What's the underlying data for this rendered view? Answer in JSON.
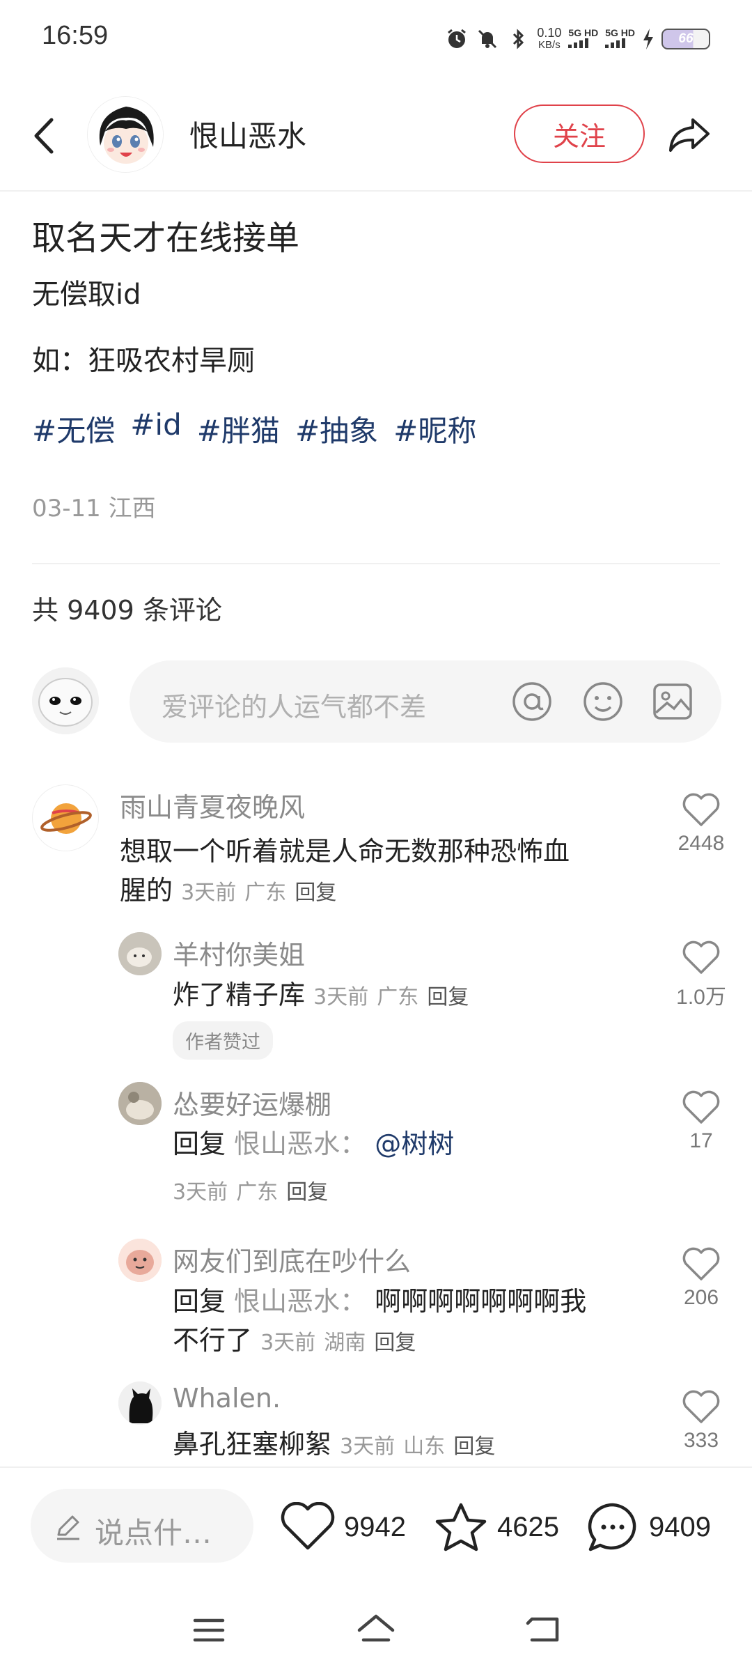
{
  "status_bar": {
    "time": "16:59",
    "net_speed_value": "0.10",
    "net_speed_unit": "KB/s",
    "net1": "5G HD",
    "net2": "5G HD",
    "battery": "66"
  },
  "header": {
    "author": "恨山恶水",
    "follow_label": "关注"
  },
  "post": {
    "title": "取名天才在线接单",
    "line1": "无偿取id",
    "line2": "如：狂吸农村旱厕",
    "tags": [
      "#无偿",
      "#id",
      "#胖猫",
      "#抽象",
      "#昵称"
    ],
    "date": "03-11",
    "location": "江西"
  },
  "comments_header": {
    "count_text": "共 9409 条评论"
  },
  "comment_input": {
    "placeholder": "爱评论的人运气都不差"
  },
  "comments": [
    {
      "name": "雨山青夏夜晚风",
      "text_line1": "想取一个听着就是人命无数那种恐怖血",
      "text_line2": "腥的",
      "time": "3天前",
      "location": "广东",
      "reply": "回复",
      "likes": "2448"
    },
    {
      "name": "羊村你美姐",
      "text": "炸了精子库",
      "time": "3天前",
      "location": "广东",
      "reply": "回复",
      "badge": "作者赞过",
      "likes": "1.0万"
    },
    {
      "name": "怂要好运爆棚",
      "reply_prefix": "回复",
      "reply_to": "恨山恶水：",
      "mention": "@树树",
      "time": "3天前",
      "location": "广东",
      "reply": "回复",
      "likes": "17"
    },
    {
      "name": "网友们到底在吵什么",
      "reply_prefix": "回复",
      "reply_to": "恨山恶水：",
      "text_line1": "啊啊啊啊啊啊啊我",
      "text_line2": "不行了",
      "time": "3天前",
      "location": "湖南",
      "reply": "回复",
      "likes": "206"
    },
    {
      "name": "Whalen.",
      "text": "鼻孔狂塞柳絮",
      "time": "3天前",
      "location": "山东",
      "reply": "回复",
      "likes": "333"
    }
  ],
  "bottom_bar": {
    "say_placeholder": "说点什…",
    "likes": "9942",
    "favorites": "4625",
    "comments": "9409"
  },
  "colors": {
    "accent_red": "#e0424a",
    "tag_blue": "#1f3a6a"
  }
}
